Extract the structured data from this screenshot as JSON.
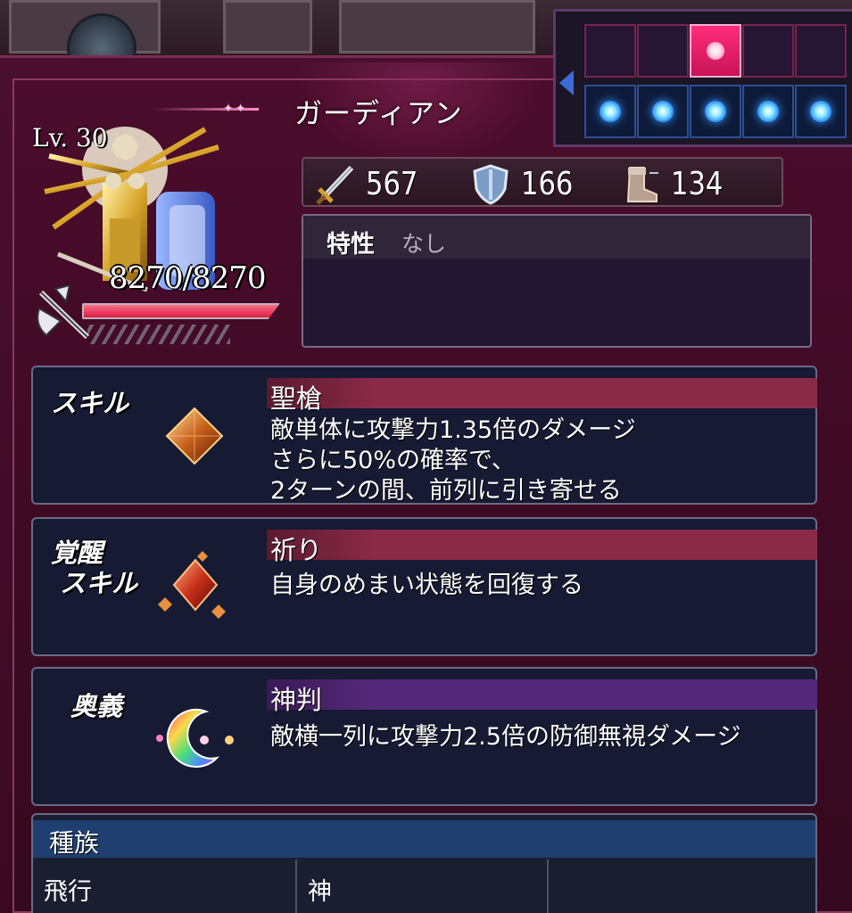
{
  "unit": {
    "name": "ガーディアン",
    "level_label": "Lv. 30",
    "hp_text": "8270/8270",
    "hp_fraction": 1.0,
    "weapon_icon": "halberd-axe-icon"
  },
  "formation": {
    "back_row": [
      false,
      false,
      true,
      false,
      false
    ],
    "front_row": [
      true,
      true,
      true,
      true,
      true
    ]
  },
  "stats": [
    {
      "icon": "sword-icon",
      "value": "567"
    },
    {
      "icon": "shield-icon",
      "value": "166"
    },
    {
      "icon": "boot-icon",
      "value": "134"
    }
  ],
  "trait": {
    "label": "特性",
    "value": "なし"
  },
  "skill": {
    "category": "スキル",
    "name": "聖槍",
    "description": "敵単体に攻撃力1.35倍のダメージ\nさらに50%の確率で、\n2ターンの間、前列に引き寄せる",
    "icon": "crystal-gem-icon"
  },
  "awakened_skill": {
    "category_line1": "覚醒",
    "category_line2": "スキル",
    "name": "祈り",
    "description": "自身のめまい状態を回復する",
    "icon": "crystal-cluster-icon"
  },
  "ougi": {
    "category": "奥義",
    "name": "神判",
    "description": "敵横一列に攻撃力2.5倍の防御無視ダメージ",
    "icon": "rainbow-crescent-icon"
  },
  "race": {
    "title": "種族",
    "values": [
      "飛行",
      "神",
      ""
    ]
  },
  "colors": {
    "frame": "#4a0f2e",
    "panel": "#161a33",
    "skill_header": "#8a2a48",
    "ougi_header": "#55297a",
    "race_header": "#1f3f70"
  }
}
